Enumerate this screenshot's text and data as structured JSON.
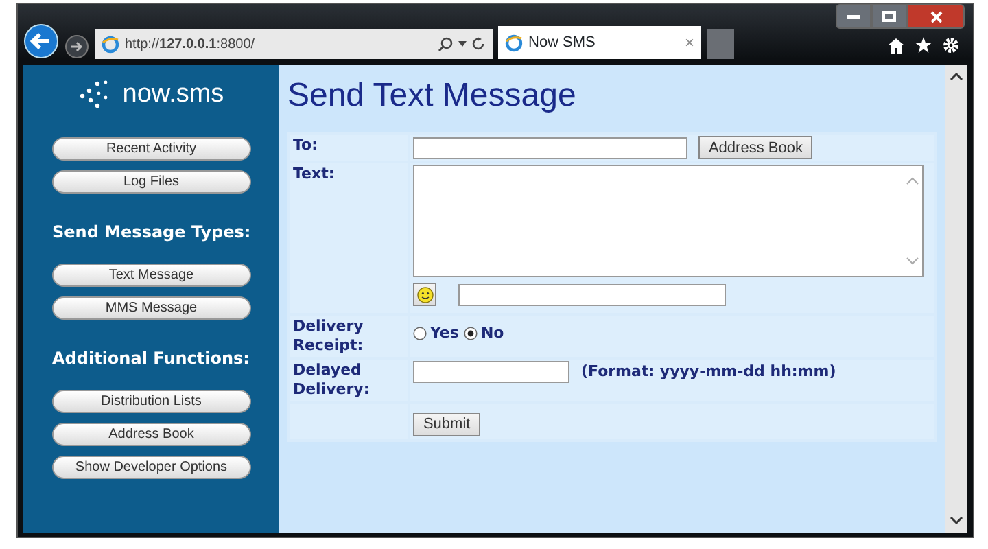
{
  "browser": {
    "url": "http://**127.0.0.1**:8800/",
    "tab_title": "Now SMS",
    "tab_close": "×"
  },
  "sidebar": {
    "logo": "now.sms",
    "items": [
      {
        "kind": "button",
        "label": "Recent Activity"
      },
      {
        "kind": "button",
        "label": "Log Files"
      },
      {
        "kind": "heading",
        "label": "Send Message Types:"
      },
      {
        "kind": "button",
        "label": "Text Message"
      },
      {
        "kind": "button",
        "label": "MMS Message"
      },
      {
        "kind": "heading",
        "label": "Additional Functions:"
      },
      {
        "kind": "button",
        "label": "Distribution Lists"
      },
      {
        "kind": "button",
        "label": "Address Book"
      },
      {
        "kind": "button",
        "label": "Show Developer Options"
      }
    ]
  },
  "page_title": "Send Text Message",
  "form": {
    "to_label": "To:",
    "address_book_button": "Address Book",
    "text_label": "Text:",
    "delivery_receipt_label": "Delivery Receipt:",
    "delivery_receipt_options": [
      {
        "label": "Yes",
        "selected": false
      },
      {
        "label": "No",
        "selected": true
      }
    ],
    "delayed_delivery_label": "Delayed Delivery:",
    "delayed_format_hint": "(Format: yyyy-mm-dd hh:mm)",
    "submit_button": "Submit"
  }
}
